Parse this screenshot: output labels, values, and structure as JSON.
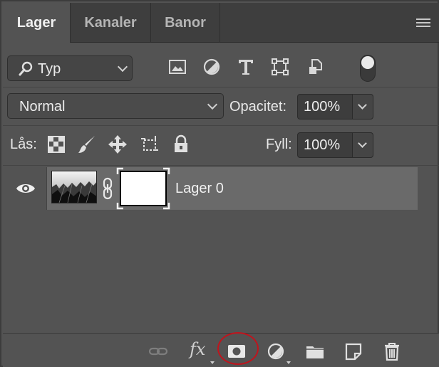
{
  "tabs": [
    {
      "label": "Lager",
      "active": true
    },
    {
      "label": "Kanaler",
      "active": false
    },
    {
      "label": "Banor",
      "active": false
    }
  ],
  "filter": {
    "kind_label": "Typ",
    "icons": [
      "image-filter-icon",
      "adjustment-filter-icon",
      "type-filter-icon",
      "shape-filter-icon",
      "smart-object-filter-icon"
    ]
  },
  "blend": {
    "mode": "Normal",
    "opacity_label": "Opacitet:",
    "opacity_value": "100%"
  },
  "lock": {
    "label": "Lås:",
    "fill_label": "Fyll:",
    "fill_value": "100%"
  },
  "layers": [
    {
      "name": "Lager 0",
      "visible": true,
      "has_mask": true
    }
  ],
  "bottom_toolbar": {
    "items": [
      "link-layers",
      "fx",
      "add-layer-mask",
      "adjustment-layer",
      "new-group",
      "new-layer",
      "delete-layer"
    ],
    "fx_label": "fx"
  },
  "colors": {
    "panel_bg": "#535353",
    "selected_layer_bg": "#6a6a6a",
    "highlight": "#c0141d"
  }
}
